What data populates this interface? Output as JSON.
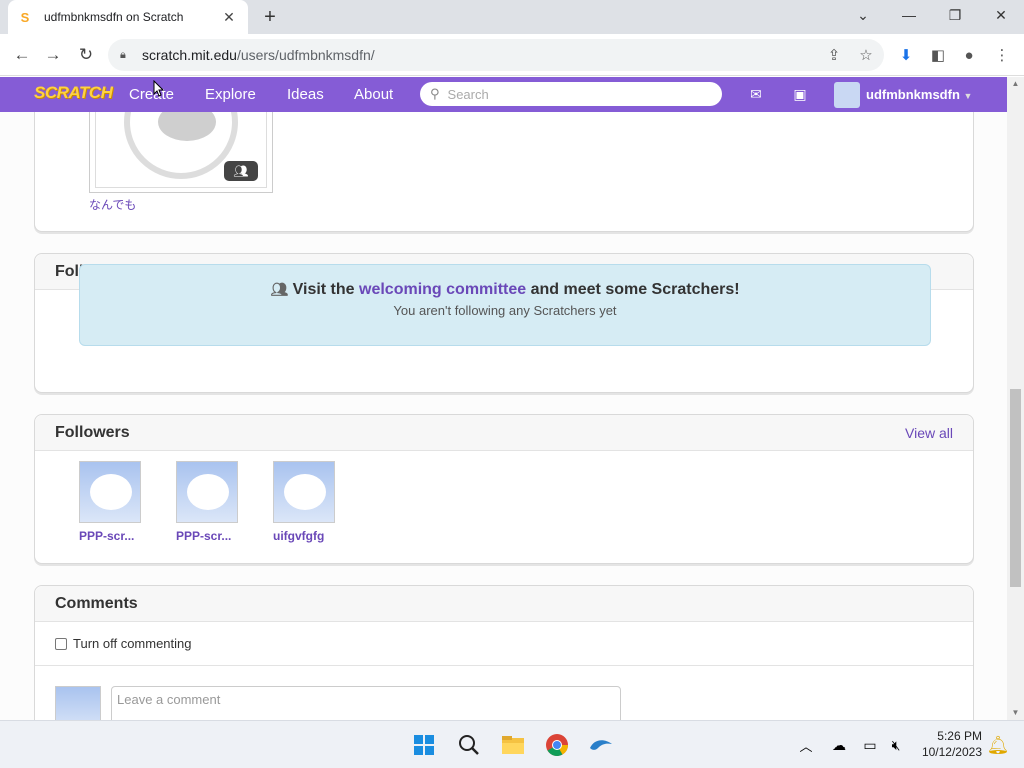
{
  "browser": {
    "tab_title": "udfmbnkmsdfn on Scratch",
    "favicon": "S",
    "url_domain": "scratch.mit.edu",
    "url_path": "/users/udfmbnkmsdfn/"
  },
  "scratch_nav": {
    "logo": "SCRATCH",
    "links": [
      "Create",
      "Explore",
      "Ideas",
      "About"
    ],
    "search_placeholder": "Search",
    "username": "udfmbnkmsdfn",
    "accent": "#855cd6"
  },
  "studio": {
    "name": "なんでも"
  },
  "following": {
    "title": "Following",
    "welcome_prefix": "Visit the",
    "welcome_link": "welcoming committee",
    "welcome_suffix": "and meet some Scratchers!",
    "welcome_sub": "You aren't following any Scratchers yet"
  },
  "followers": {
    "title": "Followers",
    "view_all": "View all",
    "items": [
      {
        "name": "PPP-scr..."
      },
      {
        "name": "PPP-scr..."
      },
      {
        "name": "uifgvfgfg"
      }
    ]
  },
  "comments": {
    "title": "Comments",
    "turn_off_label": "Turn off commenting",
    "input_placeholder": "Leave a comment"
  },
  "taskbar": {
    "time": "5:26 PM",
    "date": "10/12/2023"
  }
}
